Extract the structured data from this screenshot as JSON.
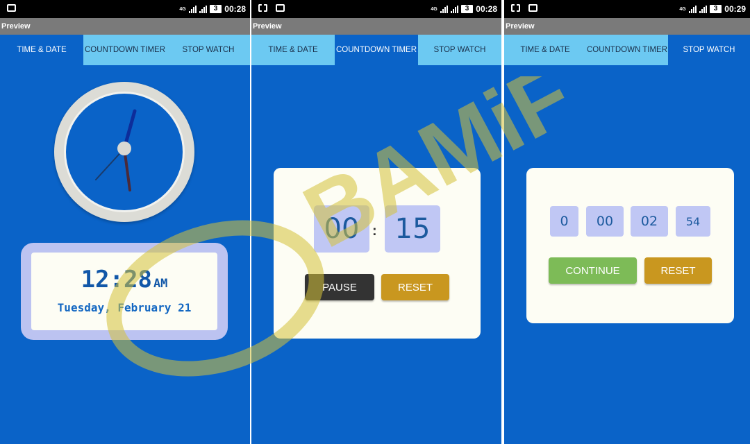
{
  "status_bar": {
    "time_1": "00:28",
    "time_2": "00:28",
    "time_3": "00:29",
    "network": "4G",
    "battery": "3"
  },
  "preview_label": "Preview",
  "tabs": [
    "TIME & DATE",
    "COUNTDOWN TIMER",
    "STOP WATCH"
  ],
  "time_date": {
    "time": "12:28",
    "ampm": "AM",
    "date": "Tuesday, February 21"
  },
  "countdown": {
    "minutes": "00",
    "separator": ":",
    "seconds": "15",
    "pause_label": "PAUSE",
    "reset_label": "RESET"
  },
  "stopwatch": {
    "hours": "0",
    "minutes": "00",
    "seconds": "02",
    "millis": "54",
    "continue_label": "CONTINUE",
    "reset_label": "RESET"
  },
  "watermark": "BAMiF",
  "colors": {
    "background": "#0a63c8",
    "tab_inactive": "#6cc9f2",
    "card": "#fdfdf4",
    "digit_box": "#c0c7f4",
    "pause": "#333333",
    "reset": "#c9971f",
    "continue": "#7dbb57",
    "watermark": "#d4c23a"
  }
}
